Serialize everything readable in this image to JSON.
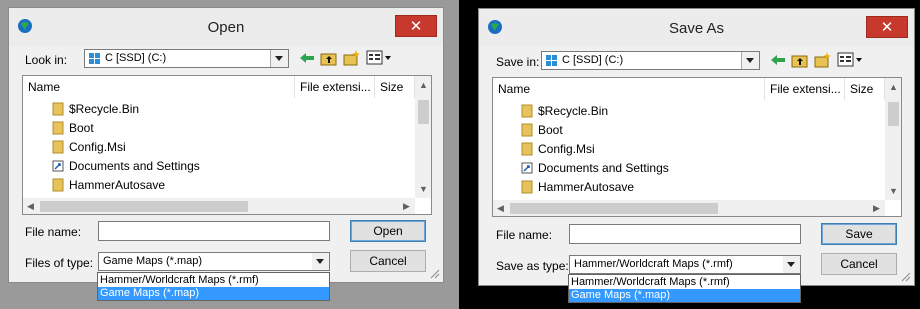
{
  "open_dialog": {
    "title": "Open",
    "close_label": "✕",
    "look_in_label": "Look in:",
    "location": "C [SSD] (C:)",
    "columns": [
      "Name",
      "File extensi...",
      "Size"
    ],
    "files": [
      {
        "name": "$Recycle.Bin",
        "icon": "folder-icon"
      },
      {
        "name": "Boot",
        "icon": "folder-icon"
      },
      {
        "name": "Config.Msi",
        "icon": "folder-icon"
      },
      {
        "name": "Documents and Settings",
        "icon": "shortcut-icon"
      },
      {
        "name": "HammerAutosave",
        "icon": "folder-icon"
      }
    ],
    "filename_label": "File name:",
    "filename_value": "",
    "filetype_label": "Files of type:",
    "filetype_value": "Game Maps (*.map)",
    "filetype_options": [
      "Hammer/Worldcraft Maps (*.rmf)",
      "Game Maps (*.map)"
    ],
    "selected_option_index": 1,
    "open_button": "Open",
    "cancel_button": "Cancel"
  },
  "save_dialog": {
    "title": "Save As",
    "close_label": "✕",
    "save_in_label": "Save in:",
    "location": "C [SSD] (C:)",
    "columns": [
      "Name",
      "File extensi...",
      "Size"
    ],
    "files": [
      {
        "name": "$Recycle.Bin",
        "icon": "folder-icon"
      },
      {
        "name": "Boot",
        "icon": "folder-icon"
      },
      {
        "name": "Config.Msi",
        "icon": "folder-icon"
      },
      {
        "name": "Documents and Settings",
        "icon": "shortcut-icon"
      },
      {
        "name": "HammerAutosave",
        "icon": "folder-icon"
      }
    ],
    "filename_label": "File name:",
    "filename_value": "",
    "filetype_label": "Save as type:",
    "filetype_value": "Hammer/Worldcraft Maps (*.rmf)",
    "filetype_options": [
      "Hammer/Worldcraft Maps (*.rmf)",
      "Game Maps (*.map)"
    ],
    "selected_option_index": 1,
    "save_button": "Save",
    "cancel_button": "Cancel"
  },
  "colors": {
    "close_red": "#c7382d",
    "selection_blue": "#3399ff",
    "dialog_bg": "#f0f0f0"
  }
}
